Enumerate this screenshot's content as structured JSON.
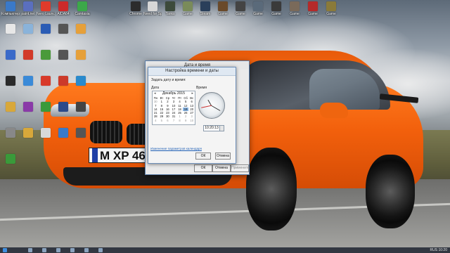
{
  "desktop": {
    "top_row": [
      {
        "label": "Компьютер",
        "color": "#3a79c9"
      },
      {
        "label": "paint.net",
        "color": "#5a6fbf"
      },
      {
        "label": "Nero Launcher",
        "color": "#e03b2b"
      },
      {
        "label": "AIDA64",
        "color": "#cc2a2a"
      },
      {
        "label": "Camtasia",
        "color": "#3ca84a"
      },
      {
        "label": "Chrome",
        "color": "#2c2c2c"
      },
      {
        "label": "Need for Speed",
        "color": "#d6d6d6"
      },
      {
        "label": "Tanks",
        "color": "#3c4a3b"
      },
      {
        "label": "Game",
        "color": "#7a8b5a"
      },
      {
        "label": "Steam",
        "color": "#2a3f5a"
      },
      {
        "label": "Game",
        "color": "#6a4a2a"
      },
      {
        "label": "Game",
        "color": "#444"
      },
      {
        "label": "Game",
        "color": "#5a6a7a"
      },
      {
        "label": "Game",
        "color": "#3a3a3a"
      },
      {
        "label": "Game",
        "color": "#7a6a5a"
      },
      {
        "label": "Game",
        "color": "#b52a2a"
      },
      {
        "label": "Game",
        "color": "#8a7a3a"
      }
    ],
    "left_icons": [
      {
        "label": "",
        "color": "#e7e7e7"
      },
      {
        "label": "",
        "color": "#8ab3da"
      },
      {
        "label": "",
        "color": "#2b5cb5"
      },
      {
        "label": "",
        "color": "#555"
      },
      {
        "label": "",
        "color": "#e6a03a"
      },
      {
        "label": "",
        "color": "#3a6ac9"
      },
      {
        "label": "",
        "color": "#d23a2a"
      },
      {
        "label": "",
        "color": "#4a9a3a"
      },
      {
        "label": "",
        "color": "#555"
      },
      {
        "label": "",
        "color": "#e6a03a"
      },
      {
        "label": "",
        "color": "#2a2a2a"
      },
      {
        "label": "",
        "color": "#3a8ad8"
      },
      {
        "label": "",
        "color": "#d83a2a"
      },
      {
        "label": "",
        "color": "#cc3a2a"
      },
      {
        "label": "",
        "color": "#2a8acc"
      },
      {
        "label": "",
        "color": "#d8a83a"
      },
      {
        "label": "",
        "color": "#8a3aa8"
      },
      {
        "label": "",
        "color": "#3a9a3a"
      },
      {
        "label": "",
        "color": "#2a4a8a"
      },
      {
        "label": "",
        "color": "#444"
      },
      {
        "label": "",
        "color": "#888"
      },
      {
        "label": "",
        "color": "#d8a83a"
      },
      {
        "label": "",
        "color": "#d8d8d8"
      },
      {
        "label": "",
        "color": "#3a7ac9"
      },
      {
        "label": "",
        "color": "#555"
      },
      {
        "label": "",
        "color": "#3a9a3a"
      }
    ]
  },
  "plate": "M XP 469",
  "dialog": {
    "title": "Дата и время",
    "ok": "ОК",
    "cancel": "Отмена",
    "apply": "Применить"
  },
  "subdialog": {
    "title": "Настройка времени и даты",
    "heading": "Задать дату и время:",
    "date_label": "Дата",
    "time_label": "Время",
    "month": "Декабрь 2015",
    "weekdays": [
      "Пн",
      "Вт",
      "Ср",
      "Чт",
      "Пт",
      "Сб",
      "Вс"
    ],
    "days": [
      [
        "30",
        "1",
        "2",
        "3",
        "4",
        "5",
        "6"
      ],
      [
        "7",
        "8",
        "9",
        "10",
        "11",
        "12",
        "13"
      ],
      [
        "14",
        "15",
        "16",
        "17",
        "18",
        "19",
        "20"
      ],
      [
        "21",
        "22",
        "23",
        "24",
        "25",
        "26",
        "27"
      ],
      [
        "28",
        "29",
        "30",
        "31",
        "1",
        "2",
        "3"
      ],
      [
        "4",
        "5",
        "6",
        "7",
        "8",
        "9",
        "10"
      ]
    ],
    "selected_day": "19",
    "time_value": "10:20:13",
    "link": "Изменение параметров календаря",
    "ok": "ОК",
    "cancel": "Отмена"
  },
  "taskbar": {
    "tray_text": "RUS  10:20"
  }
}
